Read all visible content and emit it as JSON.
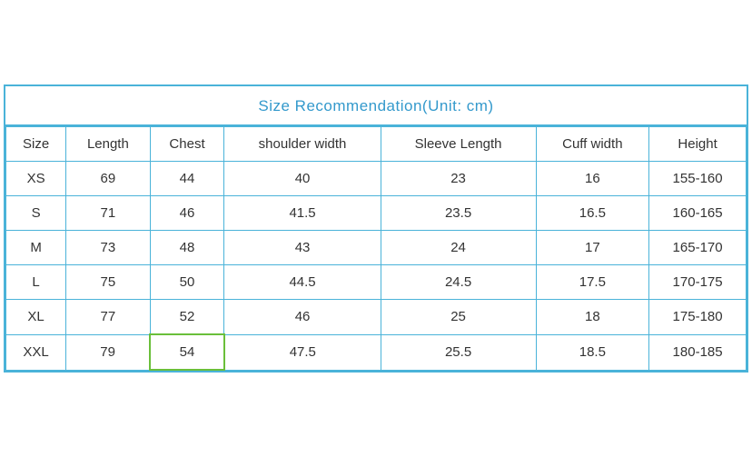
{
  "title": "Size Recommendation(Unit: cm)",
  "columns": [
    "Size",
    "Length",
    "Chest",
    "shoulder width",
    "Sleeve Length",
    "Cuff width",
    "Height"
  ],
  "rows": [
    {
      "size": "XS",
      "length": "69",
      "chest": "44",
      "shoulder_width": "40",
      "sleeve_length": "23",
      "cuff_width": "16",
      "height": "155-160",
      "highlight_chest": false
    },
    {
      "size": "S",
      "length": "71",
      "chest": "46",
      "shoulder_width": "41.5",
      "sleeve_length": "23.5",
      "cuff_width": "16.5",
      "height": "160-165",
      "highlight_chest": false
    },
    {
      "size": "M",
      "length": "73",
      "chest": "48",
      "shoulder_width": "43",
      "sleeve_length": "24",
      "cuff_width": "17",
      "height": "165-170",
      "highlight_chest": false
    },
    {
      "size": "L",
      "length": "75",
      "chest": "50",
      "shoulder_width": "44.5",
      "sleeve_length": "24.5",
      "cuff_width": "17.5",
      "height": "170-175",
      "highlight_chest": false
    },
    {
      "size": "XL",
      "length": "77",
      "chest": "52",
      "shoulder_width": "46",
      "sleeve_length": "25",
      "cuff_width": "18",
      "height": "175-180",
      "highlight_chest": false
    },
    {
      "size": "XXL",
      "length": "79",
      "chest": "54",
      "shoulder_width": "47.5",
      "sleeve_length": "25.5",
      "cuff_width": "18.5",
      "height": "180-185",
      "highlight_chest": true
    }
  ]
}
